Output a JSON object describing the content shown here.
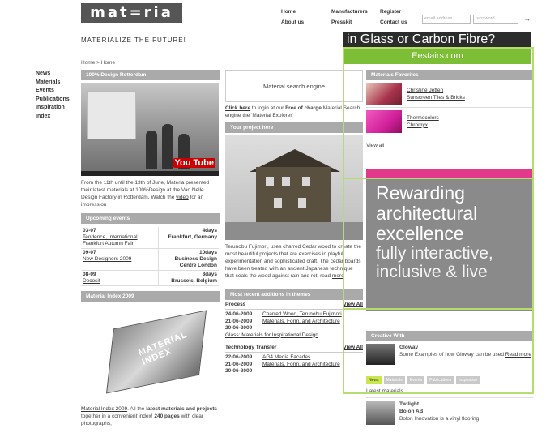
{
  "header": {
    "logo": "mat=ria",
    "tagline": "MATERIALIZE THE FUTURE!",
    "nav": [
      "Home",
      "Manufacturers",
      "Register",
      "About us",
      "Presskit",
      "Contact us"
    ],
    "email_placeholder": "email address",
    "password_placeholder": "password",
    "go_icon": "arrow-right-icon"
  },
  "banner": {
    "line1": "in Glass or Carbon Fibre?",
    "line2": "Eestairs.com"
  },
  "breadcrumb": "Home > Home",
  "sidebar": [
    "News",
    "Materials",
    "Events",
    "Publications",
    "Inspiration",
    "Index"
  ],
  "col1": {
    "design_title": "100% Design Rotterdam",
    "youtube": "You Tube",
    "design_text_pre": "From the 11th until the 13th of June, Materia presented their latest materials at 100%Design at the Van Nelle Design Factory in Rotterdam. Watch the",
    "design_link": "video",
    "design_text_post": "for an impression",
    "events_title": "Upcoming events",
    "events": [
      {
        "date": "03-07",
        "name": "Tendence, International Frankfurt Autumn Fair",
        "days": "4days",
        "place": "Frankfurt, Germany"
      },
      {
        "date": "09-07",
        "name": "New Designers 2009",
        "days": "10days",
        "place": "Business Design Centre London"
      },
      {
        "date": "08-09",
        "name": "Decosit",
        "days": "3days",
        "place": "Brussels, Belgium"
      }
    ],
    "index_title": "Material Index 2009",
    "book_text": "MATERIAL INDEX",
    "index_link": "Material Index 2009",
    "index_text1": ". All the",
    "index_bold1": "latest materials and projects",
    "index_text2": "together in a convenient index!",
    "index_bold2": "240 pages",
    "index_text3": "with clear photographs,"
  },
  "col2": {
    "search_title": "Material search engine",
    "login_link": "Click here",
    "login_text1": "to login at our",
    "login_bold": "Free of charge",
    "login_text2": "Material Search engine the 'Material Explorer'",
    "project_title": "Your project here",
    "project_text": "Terunobu Fujimori, uses charred Cedar wood to create the most beautiful projects that are exercises in playful experimentation and sophisticated craft. The cedar boards have been treated with an ancient Japanese technique that seals the wood against rain and rot.  read",
    "project_more": "more",
    "recent_title": "Most recent additions in themes",
    "process_head": "Process",
    "view_all": "View All",
    "process": [
      {
        "date": "24-06-2009",
        "title": "Charred Wood, Terunobu Fujimori"
      },
      {
        "date": "21-06-2009",
        "title": "Materials, Form, and Architecture"
      },
      {
        "date": "20-06-2009",
        "title": "Glass: Materials for Inspirational Design"
      }
    ],
    "tech_head": "Technology Transfer",
    "tech": [
      {
        "date": "22-06-2009",
        "title": "AG4 Media Facades"
      },
      {
        "date": "21-06-2009",
        "title": "Materials, Form, and Architecture"
      },
      {
        "date": "20-06-2009",
        "title": ""
      }
    ]
  },
  "col3": {
    "fav_title": "Materia's Favorites",
    "favs": [
      {
        "name": "Christine Jetten",
        "sub": "Sunscreen Tiles & Bricks",
        "color": "#a8344c"
      },
      {
        "name": "Thermocolors",
        "sub": "Chromyx",
        "color": "#d2209a"
      }
    ],
    "view_all": "View all",
    "ad_line1": "Rewarding",
    "ad_line2": "architectural",
    "ad_line3": "excellence",
    "ad_line4": "fully interactive,",
    "ad_line5": "inclusive & live",
    "creative_title": "Creative With",
    "creative_name": "Gloway",
    "creative_text": "Some Examples of how Gloway can be used",
    "creative_link": "Read more",
    "tabs": [
      "News",
      "Materials",
      "Events",
      "Publications",
      "Inspiration"
    ],
    "latest_title": "Latest materials",
    "latest_name": "Twilight",
    "latest_company": "Bolon AB",
    "latest_text": "Bolon Innovation is a vinyl flooring"
  }
}
